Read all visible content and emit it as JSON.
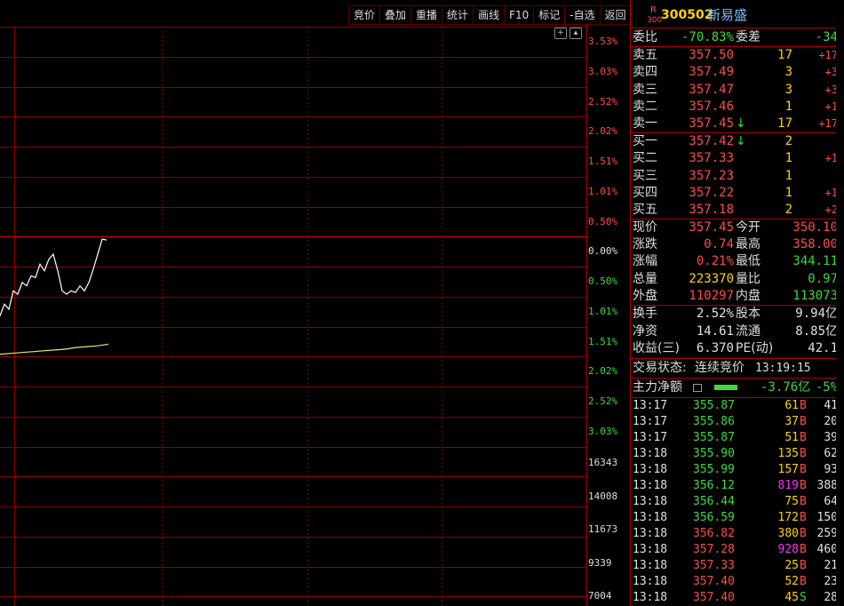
{
  "toolbar": [
    "竞价",
    "叠加",
    "重播",
    "统计",
    "画线",
    "F10",
    "标记",
    "-自选",
    "返回"
  ],
  "chart": {
    "pct_labels": [
      {
        "t": "3.53%",
        "c": "#ff4c4c"
      },
      {
        "t": "3.03%",
        "c": "#ff4c4c"
      },
      {
        "t": "2.52%",
        "c": "#ff4c4c"
      },
      {
        "t": "2.02%",
        "c": "#ff4c4c"
      },
      {
        "t": "1.51%",
        "c": "#ff4c4c"
      },
      {
        "t": "1.01%",
        "c": "#ff4c4c"
      },
      {
        "t": "0.50%",
        "c": "#ff4c4c"
      },
      {
        "t": "0.00%",
        "c": "#e0e0e0"
      },
      {
        "t": "0.50%",
        "c": "#3fd93f"
      },
      {
        "t": "1.01%",
        "c": "#3fd93f"
      },
      {
        "t": "1.51%",
        "c": "#3fd93f"
      },
      {
        "t": "2.02%",
        "c": "#3fd93f"
      },
      {
        "t": "2.52%",
        "c": "#3fd93f"
      },
      {
        "t": "3.03%",
        "c": "#3fd93f"
      }
    ],
    "vol_labels": [
      "16343",
      "14008",
      "11673",
      "9339",
      "7004"
    ],
    "price_line": [
      352.9,
      353.6,
      353.3,
      354.4,
      354.2,
      354.9,
      354.7,
      355.3,
      355.2,
      356.0,
      355.6,
      356.3,
      356.6,
      355.6,
      354.4,
      354.2,
      354.4,
      354.3,
      354.7,
      354.4,
      354.9,
      355.7,
      356.6,
      357.5,
      357.45
    ],
    "avg_line": [
      350.6,
      350.65,
      350.7,
      350.75,
      350.8,
      350.85,
      350.9,
      351.0,
      351.05,
      351.1,
      351.2
    ]
  },
  "header": {
    "code_prefix": "R",
    "code_sub": "300",
    "code": "300502",
    "name": "新易盛"
  },
  "weibi": {
    "label": "委比",
    "value": "-70.83%",
    "label2": "委差",
    "value2": "-34"
  },
  "asks": [
    {
      "label": "卖五",
      "price": "357.50",
      "vol": "17",
      "chg": "+17",
      "arrow": ""
    },
    {
      "label": "卖四",
      "price": "357.49",
      "vol": "3",
      "chg": "+3",
      "arrow": ""
    },
    {
      "label": "卖三",
      "price": "357.47",
      "vol": "3",
      "chg": "+3",
      "arrow": ""
    },
    {
      "label": "卖二",
      "price": "357.46",
      "vol": "1",
      "chg": "+1",
      "arrow": ""
    },
    {
      "label": "卖一",
      "price": "357.45",
      "vol": "17",
      "chg": "+17",
      "arrow": "↓"
    }
  ],
  "bids": [
    {
      "label": "买一",
      "price": "357.42",
      "vol": "2",
      "chg": "",
      "arrow": "↓"
    },
    {
      "label": "买二",
      "price": "357.33",
      "vol": "1",
      "chg": "+1",
      "arrow": ""
    },
    {
      "label": "买三",
      "price": "357.23",
      "vol": "1",
      "chg": "",
      "arrow": ""
    },
    {
      "label": "买四",
      "price": "357.22",
      "vol": "1",
      "chg": "+1",
      "arrow": ""
    },
    {
      "label": "买五",
      "price": "357.18",
      "vol": "2",
      "chg": "+2",
      "arrow": ""
    }
  ],
  "quote": [
    {
      "l1": "现价",
      "v1": "357.45",
      "c1": "red",
      "l2": "今开",
      "v2": "350.10",
      "c2": "red"
    },
    {
      "l1": "涨跌",
      "v1": "0.74",
      "c1": "red",
      "l2": "最高",
      "v2": "358.00",
      "c2": "red"
    },
    {
      "l1": "涨幅",
      "v1": "0.21%",
      "c1": "red",
      "l2": "最低",
      "v2": "344.11",
      "c2": "green"
    },
    {
      "l1": "总量",
      "v1": "223370",
      "c1": "yellow",
      "l2": "量比",
      "v2": "0.97",
      "c2": "green"
    },
    {
      "l1": "外盘",
      "v1": "110297",
      "c1": "red",
      "l2": "内盘",
      "v2": "113073",
      "c2": "green"
    }
  ],
  "stats": [
    {
      "l1": "换手",
      "v1": "2.52%",
      "l2": "股本",
      "v2": "9.94亿"
    },
    {
      "l1": "净资",
      "v1": "14.61",
      "l2": "流通",
      "v2": "8.85亿"
    },
    {
      "l1": "收益(三)",
      "v1": "6.370",
      "l2": "PE(动)",
      "v2": "42.1"
    }
  ],
  "trade_status": {
    "label": "交易状态:",
    "value": "连续竞价",
    "time": "13:19:15"
  },
  "main_flow": {
    "label": "主力净额",
    "value": "-3.76亿",
    "pct": "-5%"
  },
  "ticks": [
    {
      "time": "13:17",
      "price": "355.87",
      "pc": "green",
      "vol": "61",
      "vc": "yellow",
      "side": "B",
      "sc": "red",
      "n": "41"
    },
    {
      "time": "13:17",
      "price": "355.86",
      "pc": "green",
      "vol": "37",
      "vc": "yellow",
      "side": "B",
      "sc": "red",
      "n": "20"
    },
    {
      "time": "13:17",
      "price": "355.87",
      "pc": "green",
      "vol": "51",
      "vc": "yellow",
      "side": "B",
      "sc": "red",
      "n": "39"
    },
    {
      "time": "13:18",
      "price": "355.90",
      "pc": "green",
      "vol": "135",
      "vc": "yellow",
      "side": "B",
      "sc": "red",
      "n": "62"
    },
    {
      "time": "13:18",
      "price": "355.99",
      "pc": "green",
      "vol": "157",
      "vc": "yellow",
      "side": "B",
      "sc": "red",
      "n": "93"
    },
    {
      "time": "13:18",
      "price": "356.12",
      "pc": "green",
      "vol": "819",
      "vc": "magenta",
      "side": "B",
      "sc": "red",
      "n": "388"
    },
    {
      "time": "13:18",
      "price": "356.44",
      "pc": "green",
      "vol": "75",
      "vc": "yellow",
      "side": "B",
      "sc": "red",
      "n": "64"
    },
    {
      "time": "13:18",
      "price": "356.59",
      "pc": "green",
      "vol": "172",
      "vc": "yellow",
      "side": "B",
      "sc": "red",
      "n": "150"
    },
    {
      "time": "13:18",
      "price": "356.82",
      "pc": "red",
      "vol": "380",
      "vc": "yellow",
      "side": "B",
      "sc": "red",
      "n": "259"
    },
    {
      "time": "13:18",
      "price": "357.28",
      "pc": "red",
      "vol": "928",
      "vc": "magenta",
      "side": "B",
      "sc": "red",
      "n": "460"
    },
    {
      "time": "13:18",
      "price": "357.33",
      "pc": "red",
      "vol": "25",
      "vc": "yellow",
      "side": "B",
      "sc": "red",
      "n": "21"
    },
    {
      "time": "13:18",
      "price": "357.40",
      "pc": "red",
      "vol": "52",
      "vc": "yellow",
      "side": "B",
      "sc": "red",
      "n": "23"
    },
    {
      "time": "13:18",
      "price": "357.40",
      "pc": "red",
      "vol": "45",
      "vc": "yellow",
      "side": "S",
      "sc": "green",
      "n": "28"
    }
  ]
}
